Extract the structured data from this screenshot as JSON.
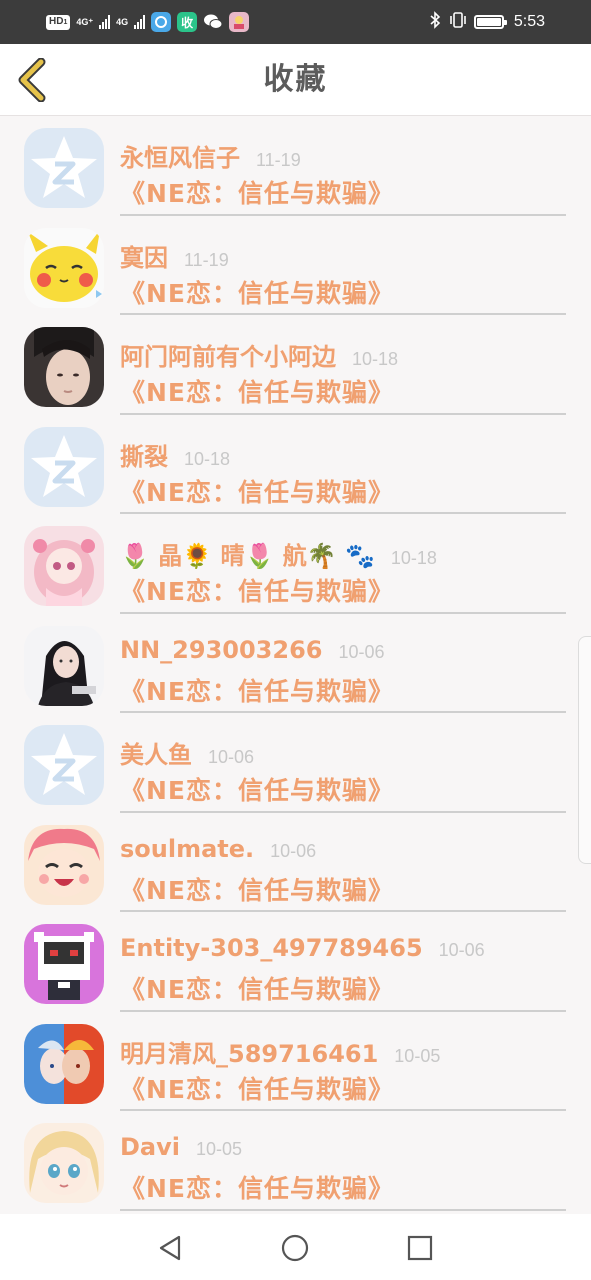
{
  "status_bar": {
    "hd_label": "HD",
    "hd_sub": "1",
    "net1": "4G⁺",
    "net2": "4G",
    "app_icon_2": "收",
    "time": "5:53",
    "icons": [
      "bluetooth-icon",
      "vibrate-icon",
      "battery-icon"
    ]
  },
  "header": {
    "title": "收藏",
    "back_icon": "chevron-left-icon",
    "accent": "#e6c34a"
  },
  "colors": {
    "name": "#f0a070",
    "date": "#c8c8c8",
    "divider": "#cfcfcf",
    "title": "#5c5c5c"
  },
  "favorites": [
    {
      "name": "永恒风信子",
      "date": "11-19",
      "story": "《NE恋：信任与欺骗》",
      "avatar": "default-qq-avatar"
    },
    {
      "name": "寞因",
      "date": "11-19",
      "story": "《NE恋：信任与欺骗》",
      "avatar": "pikachu-avatar"
    },
    {
      "name": "阿门阿前有个小阿边",
      "date": "10-18",
      "story": "《NE恋：信任与欺骗》",
      "avatar": "boy-portrait-avatar"
    },
    {
      "name": "撕裂",
      "date": "10-18",
      "story": "《NE恋：信任与欺骗》",
      "avatar": "default-qq-avatar"
    },
    {
      "name": "🌷 晶🌻 晴🌷 航🌴 🐾",
      "date": "10-18",
      "story": "《NE恋：信任与欺骗》",
      "avatar": "anime-girl-pink-avatar"
    },
    {
      "name": "NN_293003266",
      "date": "10-06",
      "story": "《NE恋：信任与欺骗》",
      "avatar": "girl-portrait-avatar"
    },
    {
      "name": "美人鱼",
      "date": "10-06",
      "story": "《NE恋：信任与欺骗》",
      "avatar": "default-qq-avatar"
    },
    {
      "name": "soulmate.",
      "date": "10-06",
      "story": "《NE恋：信任与欺骗》",
      "avatar": "anime-laughing-avatar"
    },
    {
      "name": "Entity-303_497789465",
      "date": "10-06",
      "story": "《NE恋：信任与欺骗》",
      "avatar": "pixel-cat-avatar"
    },
    {
      "name": "明月清风_589716461",
      "date": "10-05",
      "story": "《NE恋：信任与欺骗》",
      "avatar": "anime-duo-avatar"
    },
    {
      "name": "Davi",
      "date": "10-05",
      "story": "《NE恋：信任与欺骗》",
      "avatar": "anime-blonde-avatar"
    }
  ],
  "navbar": {
    "buttons": [
      "back-triangle-icon",
      "home-circle-icon",
      "recents-square-icon"
    ]
  }
}
